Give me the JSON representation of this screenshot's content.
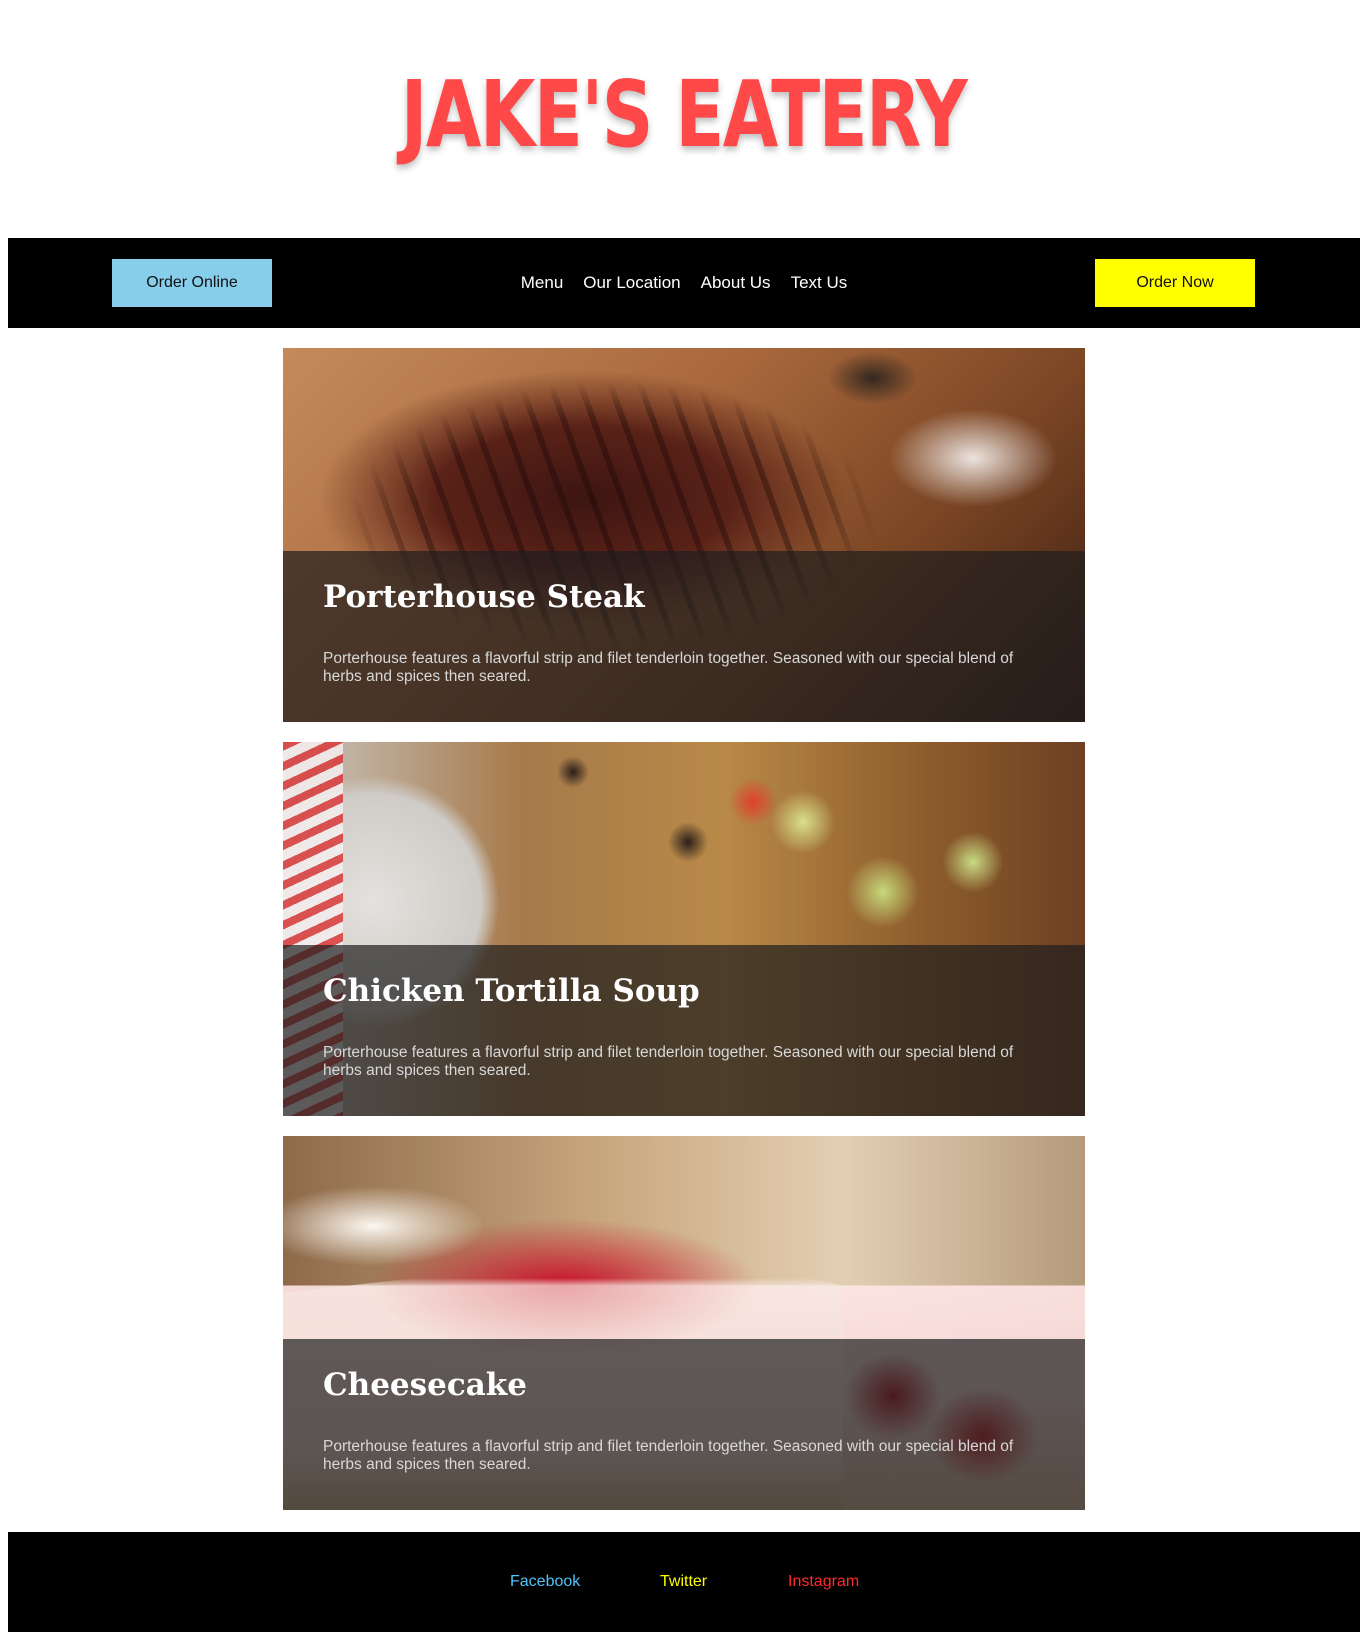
{
  "header": {
    "logo_text": "JAKE'S EATERY",
    "logo_color": "#ff4848"
  },
  "navbar": {
    "order_online_label": "Order Online",
    "order_online_color": "#87ceeb",
    "order_now_label": "Order Now",
    "order_now_color": "#ffff00",
    "links": [
      {
        "label": "Menu"
      },
      {
        "label": "Our Location"
      },
      {
        "label": "About Us"
      },
      {
        "label": "Text Us"
      }
    ]
  },
  "menu_items": [
    {
      "title": "Porterhouse Steak",
      "description": "Porterhouse features a flavorful strip and filet tenderloin together. Seasoned with our special blend of herbs and spices then seared.",
      "image": "steak-photo"
    },
    {
      "title": "Chicken Tortilla Soup",
      "description": "Porterhouse features a flavorful strip and filet tenderloin together. Seasoned with our special blend of herbs and spices then seared.",
      "image": "soup-photo"
    },
    {
      "title": "Cheesecake",
      "description": "Porterhouse features a flavorful strip and filet tenderloin together. Seasoned with our special blend of herbs and spices then seared.",
      "image": "cheesecake-photo"
    }
  ],
  "footer": {
    "links": [
      {
        "label": "Facebook",
        "color": "#4fc3f7"
      },
      {
        "label": "Twitter",
        "color": "#ffff00"
      },
      {
        "label": "Instagram",
        "color": "#ff2a2a"
      }
    ]
  }
}
